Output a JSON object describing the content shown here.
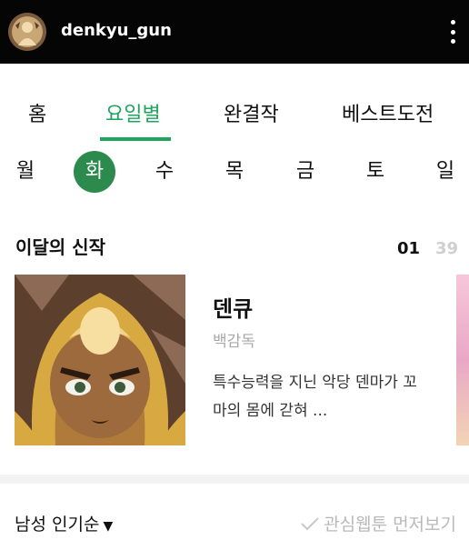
{
  "header": {
    "username": "denkyu_gun"
  },
  "tabs": [
    {
      "label": "홈",
      "active": false
    },
    {
      "label": "요일별",
      "active": true
    },
    {
      "label": "완결작",
      "active": false
    },
    {
      "label": "베스트도전",
      "active": false
    }
  ],
  "accent_color": "#1fa55b",
  "days": [
    "월",
    "화",
    "수",
    "목",
    "금",
    "토",
    "일"
  ],
  "selected_day": "화",
  "new_this_month": {
    "title": "이달의 신작",
    "page_current": "01",
    "page_total": "39",
    "card": {
      "title": "덴큐",
      "author": "백감독",
      "description": "특수능력을 지닌 악당 덴마가 꼬마의 몸에 갇혀 ..."
    }
  },
  "sort": {
    "label": "남성 인기순",
    "favorites_first": "관심웹툰 먼저보기"
  }
}
